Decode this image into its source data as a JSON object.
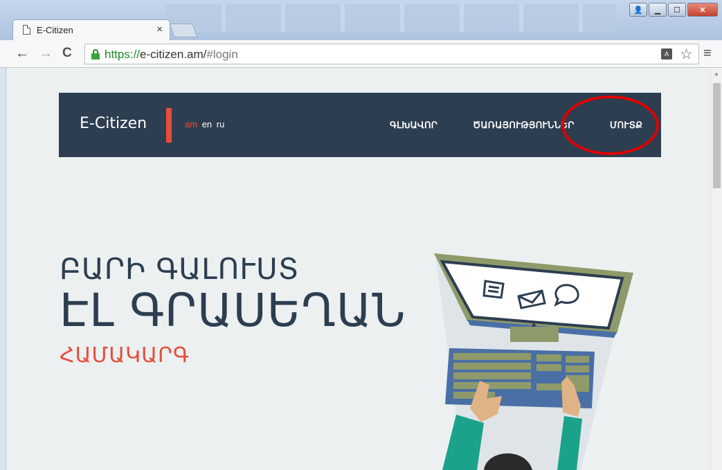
{
  "browser": {
    "tab_title": "E-Citizen",
    "tab_close": "×",
    "url_scheme": "https://",
    "url_host": "e-citizen.am/",
    "url_path": "#login",
    "window_controls": {
      "user": "👤",
      "minimize": "▁",
      "maximize": "☐",
      "close": "✕"
    },
    "nav": {
      "back": "←",
      "forward": "→",
      "reload": "C",
      "menu": "≡",
      "star": "☆",
      "translate": "A"
    }
  },
  "site": {
    "brand": "E-Citizen",
    "languages": [
      {
        "label": "am",
        "active": true
      },
      {
        "label": "en",
        "active": false
      },
      {
        "label": "ru",
        "active": false
      }
    ],
    "nav": {
      "main": "ԳԼԽԱՎՈՐ",
      "services": "ԾԱՌԱՅՈՒԹՅՈՒՆՆԵՐ",
      "login": "ՄՈՒՏՔ"
    }
  },
  "hero": {
    "line1": "ԲԱՐԻ ԳԱԼՈՒՍՏ",
    "line2": "ԷԼ ԳՐԱՍԵՂԱՆ",
    "line3": "ՀԱՄԱԿԱՐԳ"
  },
  "colors": {
    "header_bg": "#2c3e50",
    "accent_red": "#e74c3c",
    "page_bg": "#ecf0f1",
    "annotation_ring": "#e00000"
  }
}
